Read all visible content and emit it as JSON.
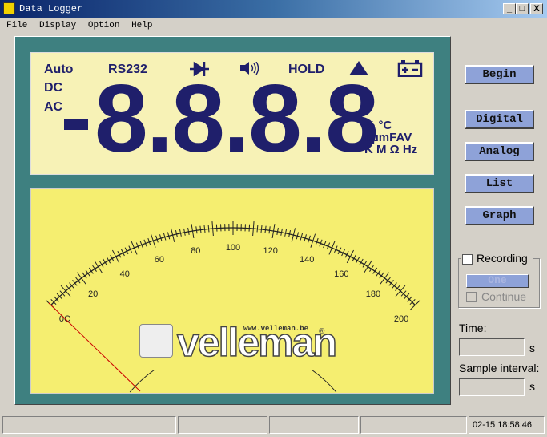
{
  "window": {
    "title": "Data Logger",
    "controls": [
      "_",
      "□",
      "X"
    ]
  },
  "menu": [
    "File",
    "Display",
    "Option",
    "Help"
  ],
  "lcd": {
    "auto": "Auto",
    "rs232": "RS232",
    "hold": "HOLD",
    "dc": "DC",
    "ac": "AC",
    "digits": "8.8.8.8",
    "sign": "-",
    "units_line1": "% °C",
    "units_line2": "nµmFAV",
    "units_line3": "K M Ω Hz",
    "icons": [
      "diode-icon",
      "speaker-icon",
      "triangle-up-icon",
      "battery-icon"
    ]
  },
  "dial": {
    "min": 0,
    "max": 200,
    "unit": "C",
    "labels": [
      "0",
      "20",
      "40",
      "60",
      "80",
      "100",
      "120",
      "140",
      "160",
      "180",
      "200"
    ],
    "needle_value": 0,
    "brand": "velleman",
    "brand_url": "www.velleman.be",
    "registered": "®",
    "colors": {
      "face": "#f5ee70",
      "needle": "#cc0000"
    }
  },
  "buttons": {
    "begin": "Begin",
    "digital": "Digital",
    "analog": "Analog",
    "list": "List",
    "graph": "Graph"
  },
  "recording": {
    "label": "Recording",
    "one": "One",
    "continue": "Continue",
    "checked": false
  },
  "time": {
    "label": "Time:",
    "unit": "s",
    "value": ""
  },
  "sample": {
    "label": "Sample interval:",
    "unit": "s",
    "value": ""
  },
  "status": {
    "datetime": "02-15 18:58:46"
  }
}
